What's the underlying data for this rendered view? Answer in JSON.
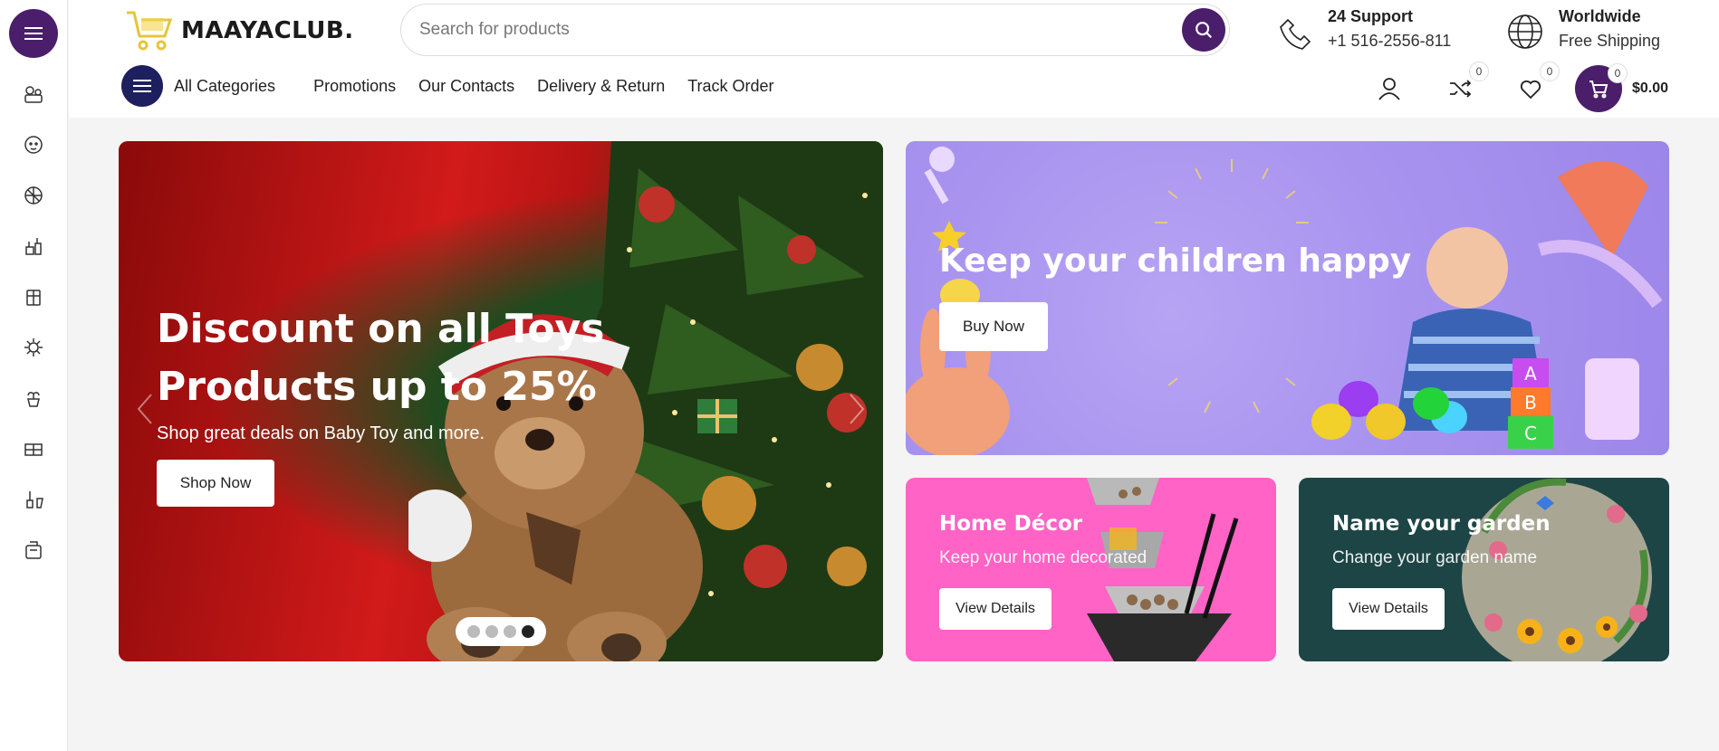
{
  "brand": {
    "name": "MAAYACLUB.",
    "accent": "#4b1e6b",
    "category_button": "#1d1f5e"
  },
  "search": {
    "placeholder": "Search for products"
  },
  "support": {
    "title": "24 Support",
    "phone": "+1 516-2556-811",
    "icon": "support-icon"
  },
  "shipping": {
    "title": "Worldwide",
    "subtitle": "Free Shipping",
    "icon": "globe-icon"
  },
  "nav": {
    "categories_label": "All Categories",
    "links": [
      "Promotions",
      "Our Contacts",
      "Delivery & Return",
      "Track Order"
    ]
  },
  "header_actions": {
    "compare_count": "0",
    "wishlist_count": "0",
    "cart_count": "0",
    "cart_total": "$0.00"
  },
  "sidebar": {
    "icons": [
      "toys-icon",
      "baby-icon",
      "sports-icon",
      "garden-tools-icon",
      "gifts-icon",
      "gear-icon",
      "plants-icon",
      "furniture-icon",
      "gardening-icon",
      "kitchen-icon"
    ]
  },
  "hero": {
    "title": "Discount on all Toys Products up to 25%",
    "subtitle": "Shop great deals on Baby Toy and more.",
    "cta": "Shop Now",
    "slides": 4,
    "active_slide": 4
  },
  "kids_banner": {
    "title": "Keep your children happy",
    "cta": "Buy Now"
  },
  "home_banner": {
    "title": "Home Décor",
    "subtitle": "Keep your home decorated",
    "cta": "View Details"
  },
  "garden_banner": {
    "title": "Name your garden",
    "subtitle": "Change your garden name",
    "cta": "View Details"
  }
}
